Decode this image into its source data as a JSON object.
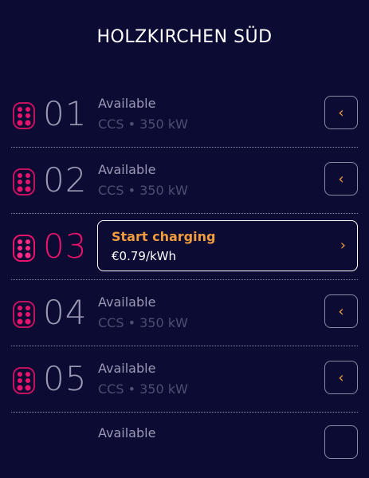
{
  "header": {
    "title": "HOLZKIRCHEN SÜD"
  },
  "colors": {
    "background": "#0b0b33",
    "accent": "#e8136b",
    "orange": "#f39c3d"
  },
  "chargers": [
    {
      "number": "01",
      "status": "Available",
      "spec": "CCS • 350 kW",
      "icon": "ccs-connector-icon",
      "button_icon": "chevron-left-icon"
    },
    {
      "number": "02",
      "status": "Available",
      "spec": "CCS • 350 kW",
      "icon": "ccs-connector-icon",
      "button_icon": "chevron-left-icon"
    },
    {
      "number": "03",
      "action_label": "Start charging",
      "price": "€0.79/kWh",
      "icon": "ccs-connector-icon",
      "button_icon": "chevron-right-icon"
    },
    {
      "number": "04",
      "status": "Available",
      "spec": "CCS • 350 kW",
      "icon": "ccs-connector-icon",
      "button_icon": "chevron-left-icon"
    },
    {
      "number": "05",
      "status": "Available",
      "spec": "CCS • 350 kW",
      "icon": "ccs-connector-icon",
      "button_icon": "chevron-left-icon"
    },
    {
      "status": "Available",
      "icon": "ccs-connector-icon"
    }
  ]
}
